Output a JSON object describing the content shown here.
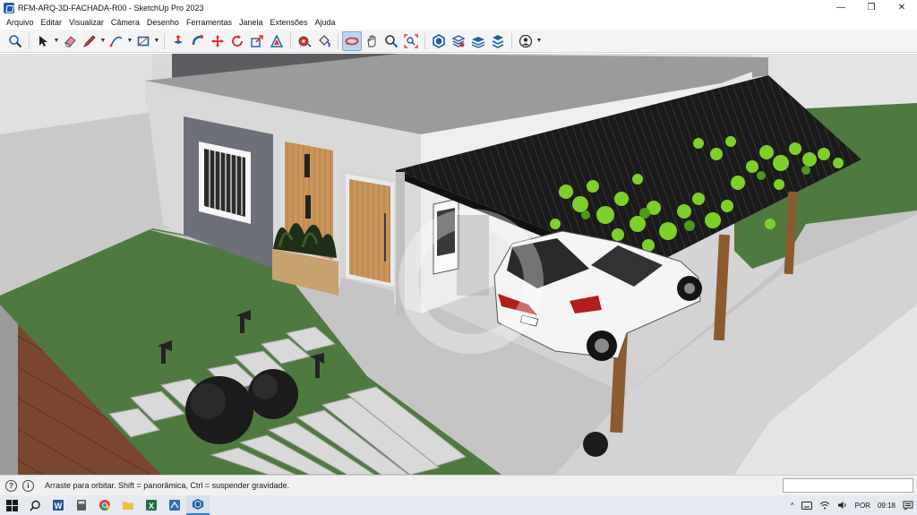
{
  "window": {
    "title": "RFM-ARQ-3D-FACHADA-R00 - SketchUp Pro 2023",
    "minimize_glyph": "—",
    "maximize_glyph": "❐",
    "close_glyph": "✕"
  },
  "menu": {
    "items": [
      "Arquivo",
      "Editar",
      "Visualizar",
      "Câmera",
      "Desenho",
      "Ferramentas",
      "Janela",
      "Extensões",
      "Ajuda"
    ]
  },
  "toolbar": {
    "tools": [
      {
        "name": "zoom-extents-icon"
      },
      {
        "name": "select-icon",
        "dropdown": true
      },
      {
        "name": "eraser-icon"
      },
      {
        "name": "pencil-line-icon",
        "dropdown": true
      },
      {
        "name": "arc-icon",
        "dropdown": true
      },
      {
        "name": "rectangle-icon",
        "dropdown": true
      },
      {
        "name": "push-pull-icon"
      },
      {
        "name": "follow-me-icon"
      },
      {
        "name": "move-icon"
      },
      {
        "name": "rotate-icon"
      },
      {
        "name": "scale-icon"
      },
      {
        "name": "offset-icon"
      },
      {
        "name": "tape-measure-icon"
      },
      {
        "name": "paint-bucket-icon"
      },
      {
        "name": "orbit-icon",
        "active": true
      },
      {
        "name": "pan-icon"
      },
      {
        "name": "zoom-icon"
      },
      {
        "name": "zoom-window-icon"
      },
      {
        "name": "warehouse-icon"
      },
      {
        "name": "extension-warehouse-icon"
      },
      {
        "name": "layers-icon"
      },
      {
        "name": "extension-manager-icon"
      },
      {
        "name": "account-icon",
        "dropdown": true
      }
    ]
  },
  "status": {
    "info_glyph": "i",
    "hint_glyph": "?",
    "text": "Arraste para orbitar. Shift = panorâmica, Ctrl = suspender gravidade.",
    "measurements_value": ""
  },
  "taskbar": {
    "apps": [
      {
        "name": "windows-start-icon"
      },
      {
        "name": "search-icon"
      },
      {
        "name": "word-icon"
      },
      {
        "name": "calculator-icon"
      },
      {
        "name": "chrome-icon"
      },
      {
        "name": "file-explorer-icon"
      },
      {
        "name": "excel-icon"
      },
      {
        "name": "sketchup-layout-icon"
      },
      {
        "name": "sketchup-icon",
        "active": true
      }
    ],
    "tray": {
      "chevron": "^",
      "language": "POR",
      "time": "09:18"
    }
  },
  "colors": {
    "accent": "#3a7bd5",
    "active_tool": "#b9d6f2",
    "grass": "#4f7a3f",
    "wood": "#c8955a"
  }
}
